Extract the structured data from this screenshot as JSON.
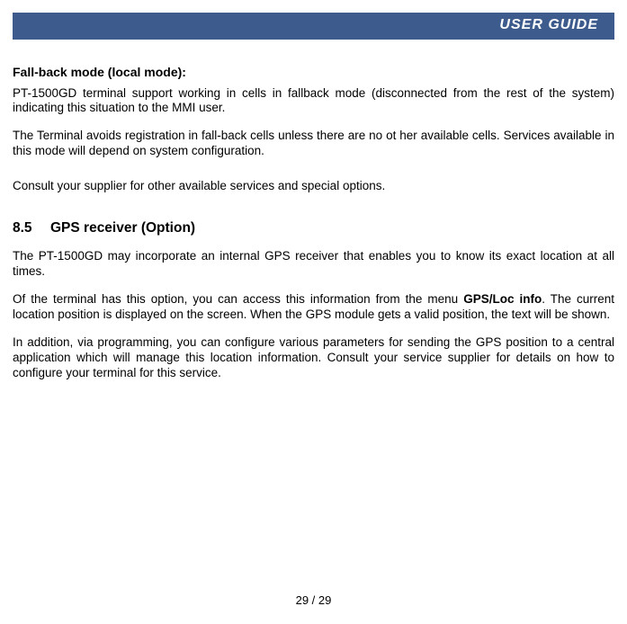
{
  "header": {
    "title": "USER GUIDE"
  },
  "section_fallback": {
    "heading": "Fall-back mode (local mode):",
    "p1": "PT-1500GD terminal support working in cells in fallback mode (disconnected from the rest of the system) indicating this situation to the MMI user.",
    "p2": "The Terminal avoids registration in fall-back cells unless there are no ot her available cells. Services available in this mode will depend on system configuration.",
    "p3": "Consult your supplier for other available services and special options."
  },
  "section_gps": {
    "number": "8.5",
    "title": "GPS receiver (Option)",
    "p1": "The PT-1500GD may incorporate an internal GPS receiver that enables you to know its exact location at all times.",
    "p2a": "Of the terminal has this option, you can access this information from the menu ",
    "p2b_bold": "GPS/Loc info",
    "p2c": ". The current location position is displayed on the screen. When the GPS module gets a valid position, the text will be shown.",
    "p3": "In addition, via programming, you can configure various parameters for sending the GPS position to a central application which will manage this location information. Consult your service supplier for details on how to configure your terminal for this service."
  },
  "footer": {
    "page": "29 / 29"
  }
}
